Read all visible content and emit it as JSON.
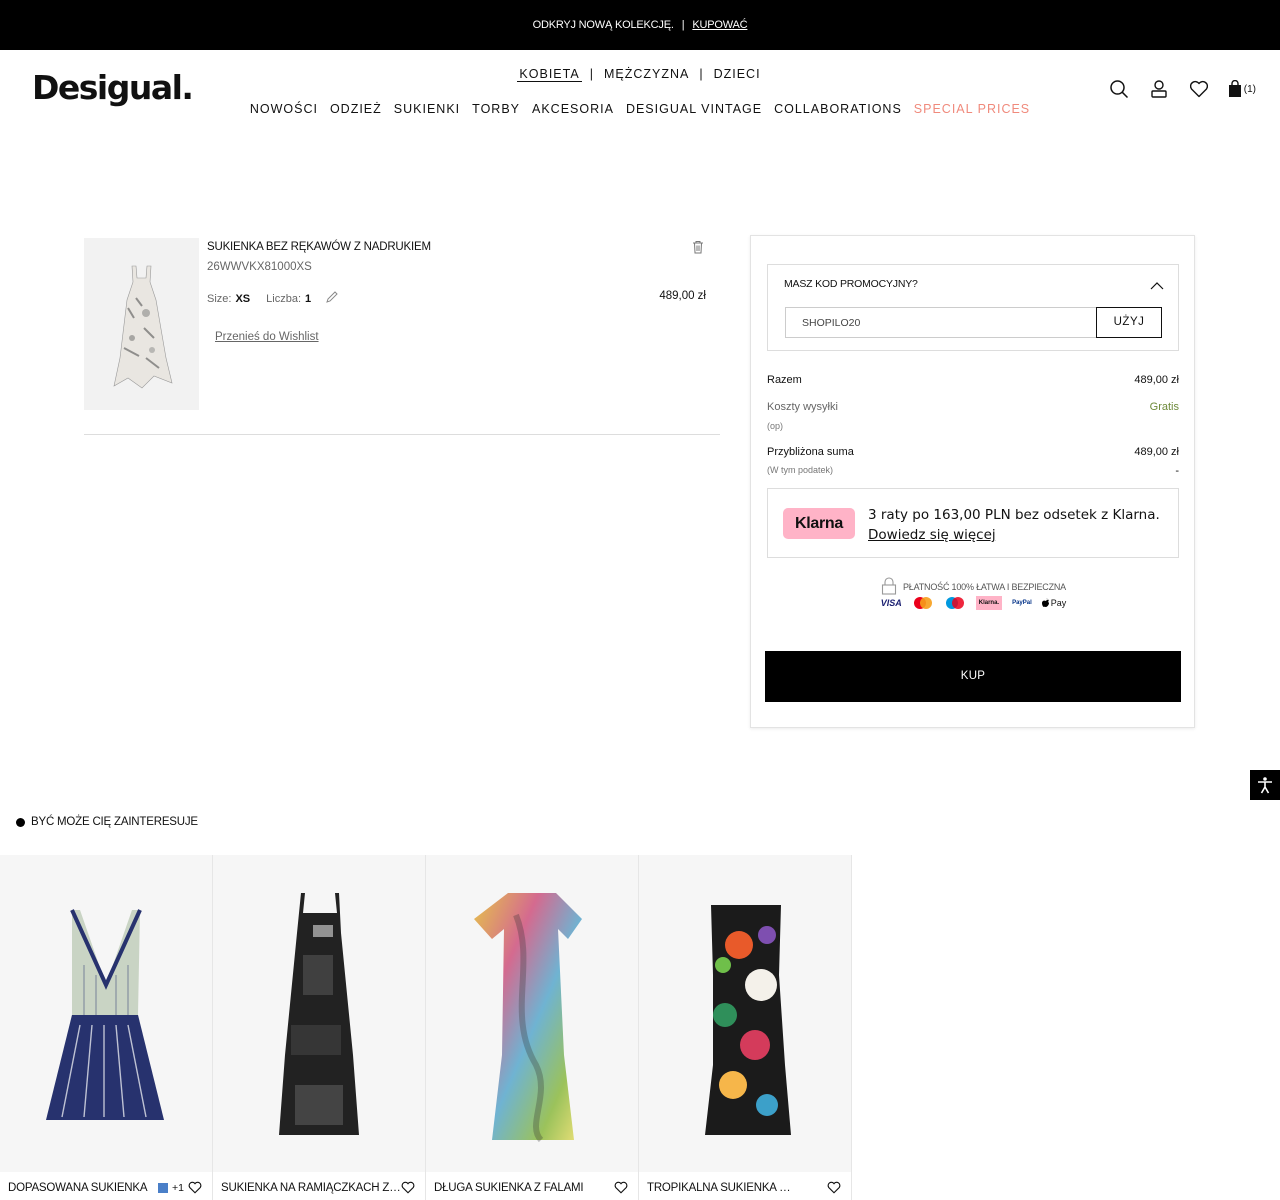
{
  "topbar": {
    "text": "ODKRYJ NOWĄ KOLEKCJĘ.",
    "separator": "|",
    "link": "KUPOWAĆ"
  },
  "header": {
    "logo": "Desigual.",
    "gender_nav": [
      "KOBIETA",
      "MĘŻCZYZNA",
      "DZIECI"
    ],
    "gender_separator": "|",
    "categories": [
      "NOWOŚCI",
      "ODZIEŻ",
      "SUKIENKI",
      "TORBY",
      "AKCESORIA",
      "DESIGUAL VINTAGE",
      "COLLABORATIONS"
    ],
    "special": "SPECIAL PRICES",
    "cart_count": "(1)",
    "accent_color": "#f08a7c"
  },
  "cart_item": {
    "title": "SUKIENKA BEZ RĘKAWÓW Z NADRUKIEM",
    "ref": "26WWVKX81000XS",
    "size_label": "Size:",
    "size_value": "XS",
    "qty_label": "Liczba:",
    "qty_value": "1",
    "price": "489,00 zł",
    "wishlist_link": "Przenieś do Wishlist"
  },
  "summary": {
    "promo_title": "MASZ KOD PROMOCYJNY?",
    "promo_value": "SHOPILO20",
    "promo_button": "UŻYJ",
    "subtotal_label": "Razem",
    "subtotal_value": "489,00 zł",
    "shipping_label": "Koszty wysyłki",
    "shipping_note": "(op)",
    "shipping_value": "Gratis",
    "total_label": "Przybliżona suma",
    "total_note": "(W tym podatek)",
    "total_value": "489,00 zł",
    "total_tax": "-",
    "klarna_badge": "Klarna",
    "klarna_text": "3 raty po 163,00 PLN bez odsetek z Klarna.",
    "klarna_link": "Dowiedz się więcej",
    "secure_text": "PŁATNOŚĆ 100%  ŁATWA I BEZPIECZNA",
    "payments": [
      "VISA",
      "Klarna.",
      "PayPal",
      "Pay"
    ],
    "buy_button": "KUP"
  },
  "recommendations": {
    "title": "BYĆ MOŻE CIĘ ZAINTERESUJE",
    "products": [
      {
        "name": "DOPASOWANA SUKIENKA",
        "extra": "+1"
      },
      {
        "name": "SUKIENKA NA RAMIĄCZKACH Z NADRUKIEM"
      },
      {
        "name": "DŁUGA SUKIENKA Z FALAMI"
      },
      {
        "name": "TROPIKALNA SUKIENKA BEZ RĘKAWÓW"
      }
    ]
  }
}
